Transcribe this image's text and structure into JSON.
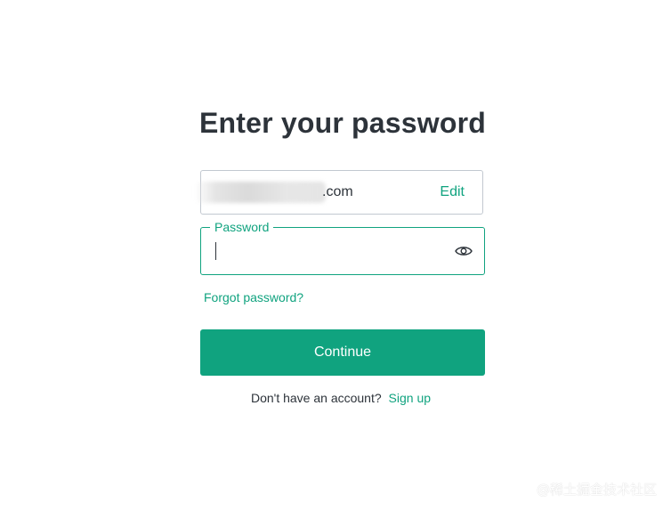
{
  "page": {
    "title": "Enter your password"
  },
  "email_field": {
    "value_suffix": ".com",
    "edit_label": "Edit"
  },
  "password_field": {
    "label": "Password",
    "value": "",
    "toggle_icon": "eye-icon"
  },
  "links": {
    "forgot_password": "Forgot password?"
  },
  "continue_button": {
    "label": "Continue"
  },
  "signup": {
    "prompt": "Don't have an account?",
    "link_label": "Sign up"
  },
  "watermark": {
    "text": "@稀土掘金技术社区"
  },
  "colors": {
    "accent": "#10a37f",
    "text": "#2d333a",
    "border": "#c2c8d0",
    "background": "#ffffff"
  }
}
